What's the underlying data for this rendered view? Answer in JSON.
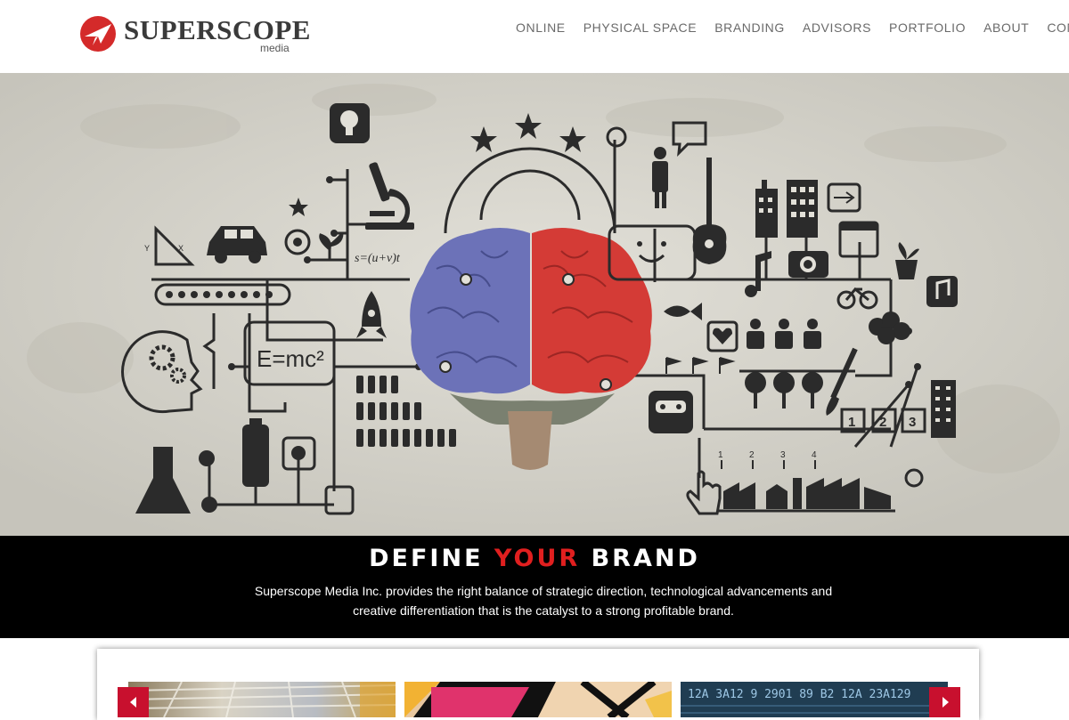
{
  "brand": {
    "name": "SUPERSCOPE",
    "sub": "media",
    "logo_icon": "plane-in-circle-icon",
    "color": "#d42a2a"
  },
  "nav": {
    "items": [
      {
        "label": "ONLINE"
      },
      {
        "label": "PHYSICAL SPACE"
      },
      {
        "label": "BRANDING"
      },
      {
        "label": "ADVISORS"
      },
      {
        "label": "PORTFOLIO"
      },
      {
        "label": "ABOUT"
      },
      {
        "label": "CONTACT"
      }
    ]
  },
  "hero": {
    "formula": "E=mc²",
    "chart_numbers": [
      "1",
      "2",
      "3",
      "4"
    ],
    "step_numbers": [
      "1",
      "2",
      "3"
    ]
  },
  "tagline": {
    "part1": "DEFINE ",
    "accent": "YOUR",
    "part2": " BRAND",
    "accent_color": "#e01f1f",
    "description": "Superscope Media Inc. provides the right balance of strategic direction, technological advancements and creative differentiation that is the catalyst to a strong profitable brand."
  },
  "carousel": {
    "prev_icon": "chevron-left-icon",
    "next_icon": "chevron-right-icon",
    "thumb3_code": "12A 3A12 9 2901 89 B2 12A 23A129"
  }
}
